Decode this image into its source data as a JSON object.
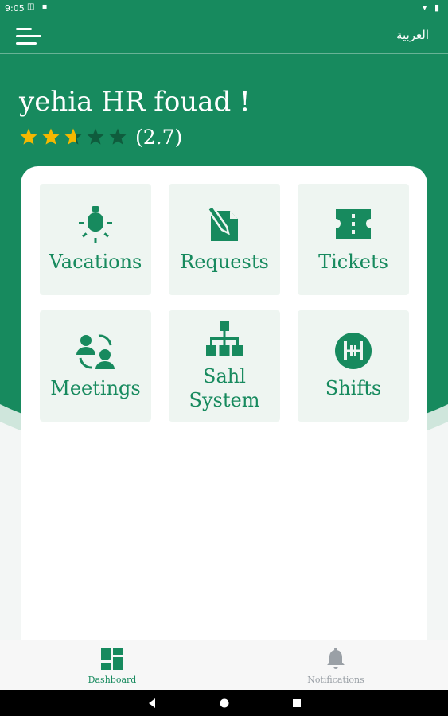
{
  "status_bar": {
    "time": "9:05"
  },
  "header": {
    "language_toggle": "العربية"
  },
  "profile": {
    "greeting": "yehia HR fouad !",
    "rating_text": "(2.7)",
    "rating_value": 2.7,
    "rating_max": 5
  },
  "colors": {
    "brand": "#178a5e",
    "star_filled": "#f5b800",
    "star_empty": "#0f5c3d",
    "tile_bg": "#eef5f1"
  },
  "tiles": [
    {
      "label": "Vacations",
      "icon": "lightbulb-icon"
    },
    {
      "label": "Requests",
      "icon": "edit-document-icon"
    },
    {
      "label": "Tickets",
      "icon": "ticket-icon"
    },
    {
      "label": "Meetings",
      "icon": "meeting-people-icon"
    },
    {
      "label_line1": "Sahl",
      "label_line2": "System",
      "icon": "org-chart-icon"
    },
    {
      "label": "Shifts",
      "icon": "shifts-icon"
    }
  ],
  "bottom_nav": [
    {
      "label": "Dashboard",
      "icon": "dashboard-icon",
      "active": true
    },
    {
      "label": "Notifications",
      "icon": "bell-icon",
      "active": false
    }
  ]
}
